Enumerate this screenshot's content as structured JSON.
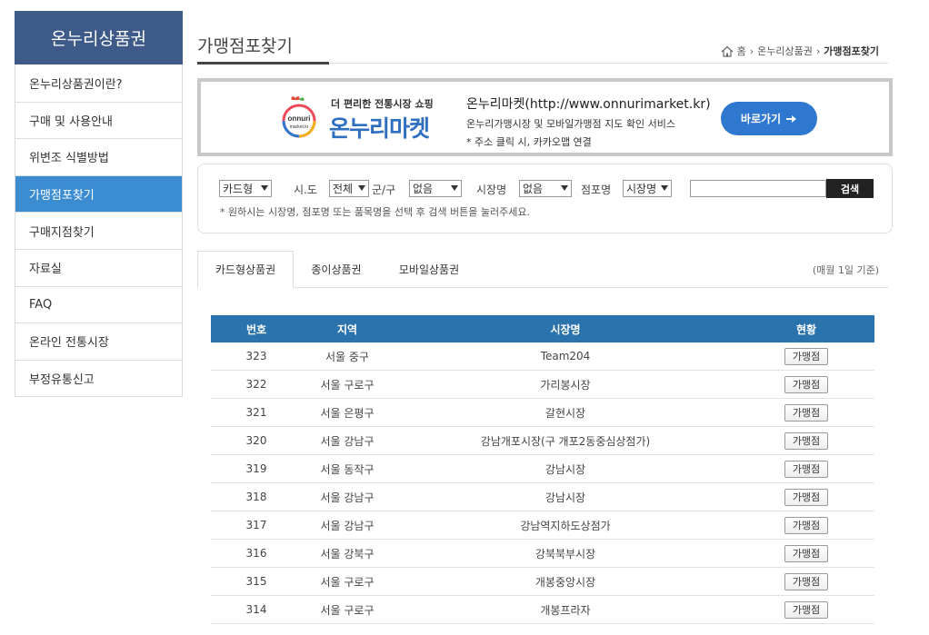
{
  "sidebar": {
    "title": "온누리상품권",
    "items": [
      {
        "label": "온누리상품권이란?"
      },
      {
        "label": "구매 및 사용안내"
      },
      {
        "label": "위변조 식별방법"
      },
      {
        "label": "가맹점포찾기"
      },
      {
        "label": "구매지점찾기"
      },
      {
        "label": "자료실"
      },
      {
        "label": "FAQ"
      },
      {
        "label": "온라인 전통시장"
      },
      {
        "label": "부정유통신고"
      }
    ],
    "active_index": 3
  },
  "header": {
    "title": "가맹점포찾기",
    "breadcrumb": [
      "홈",
      "온누리상품권",
      "가맹점포찾기"
    ]
  },
  "banner": {
    "tagline": "더 편리한 전통시장 쇼핑",
    "brand": "온누리마켓",
    "logo_text": "onnuri market.kr",
    "line1": "온누리마켓(http://www.onnurimarket.kr)",
    "line2": "온누리가맹시장 및 모바일가맹점 지도 확인 서비스",
    "line3": "* 주소 클릭 시, 카카오맵 연결",
    "button_label": "바로가기"
  },
  "search": {
    "card_type": "카드형",
    "sido_label": "시.도",
    "sido_value": "전체",
    "gungu_label": "군/구",
    "gungu_value": "없음",
    "market_label": "시장명",
    "market_value": "없음",
    "store_label": "점포명",
    "store_type": "시장명",
    "button_label": "검색",
    "note": "* 원하시는 시장명, 점포명 또는 품목명을 선택 후 검색 버튼을 눌러주세요."
  },
  "tabs": {
    "items": [
      "카드형상품권",
      "종이상품권",
      "모바일상품권"
    ],
    "active_index": 0,
    "note": "(매월 1일 기준)"
  },
  "table": {
    "headers": [
      "번호",
      "지역",
      "시장명",
      "현황"
    ],
    "rows": [
      {
        "no": "323",
        "region": "서울 중구",
        "market": "Team204",
        "status": "가맹점"
      },
      {
        "no": "322",
        "region": "서울 구로구",
        "market": "가리봉시장",
        "status": "가맹점"
      },
      {
        "no": "321",
        "region": "서울 은평구",
        "market": "갈현시장",
        "status": "가맹점"
      },
      {
        "no": "320",
        "region": "서울 강남구",
        "market": "강남개포시장(구 개포2동중심상점가)",
        "status": "가맹점"
      },
      {
        "no": "319",
        "region": "서울 동작구",
        "market": "강남시장",
        "status": "가맹점"
      },
      {
        "no": "318",
        "region": "서울 강남구",
        "market": "강남시장",
        "status": "가맹점"
      },
      {
        "no": "317",
        "region": "서울 강남구",
        "market": "강남역지하도상점가",
        "status": "가맹점"
      },
      {
        "no": "316",
        "region": "서울 강북구",
        "market": "강북북부시장",
        "status": "가맹점"
      },
      {
        "no": "315",
        "region": "서울 구로구",
        "market": "개봉중앙시장",
        "status": "가맹점"
      },
      {
        "no": "314",
        "region": "서울 구로구",
        "market": "개봉프라자",
        "status": "가맹점"
      }
    ]
  },
  "colors": {
    "sidebar_head": "#3e5a89",
    "sidebar_active": "#3b8cd0",
    "table_head": "#2b73ad",
    "banner_button": "#2f78d0"
  }
}
